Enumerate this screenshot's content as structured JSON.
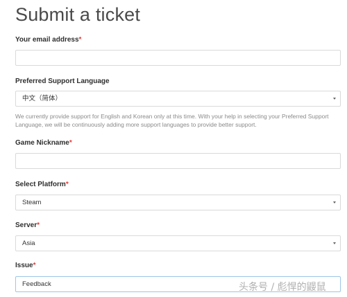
{
  "page": {
    "title": "Submit a ticket"
  },
  "form": {
    "email": {
      "label": "Your email address",
      "required_mark": "*",
      "value": ""
    },
    "language": {
      "label": "Preferred Support Language",
      "selected": "中文（简体）",
      "help": "We currently provide support for English and Korean only at this time. With your help in selecting your Preferred Support Language, we will be continuously adding more support languages to provide better support."
    },
    "nickname": {
      "label": "Game Nickname",
      "required_mark": "*",
      "value": ""
    },
    "platform": {
      "label": "Select Platform",
      "required_mark": "*",
      "selected": "Steam"
    },
    "server": {
      "label": "Server",
      "required_mark": "*",
      "selected": "Asia"
    },
    "issue": {
      "label": "Issue",
      "required_mark": "*",
      "selected": "Feedback"
    }
  },
  "watermark": {
    "text": "头条号 / 彪悍的鼹鼠"
  },
  "colors": {
    "required": "#e53935",
    "border": "#d9d9d9",
    "focus_border": "#9cc6e8",
    "help_text": "#8a8a8a"
  },
  "icons": {
    "select_caret": "chevron-down-icon"
  }
}
